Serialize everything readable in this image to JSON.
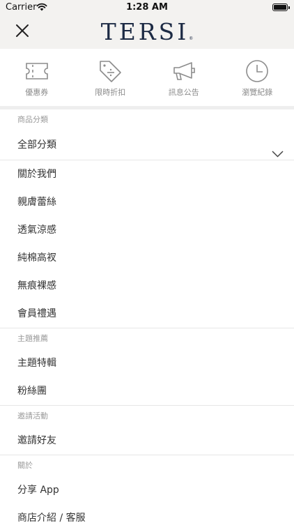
{
  "status_bar": {
    "carrier": "Carrier",
    "time": "1:28 AM",
    "battery_level": 1.0
  },
  "header": {
    "logo_text": "TERSI",
    "logo_mark": "®",
    "close_icon": "close-icon"
  },
  "shortcuts": [
    {
      "label": "優惠券",
      "icon": "ticket-icon"
    },
    {
      "label": "限時折扣",
      "icon": "discount-tag-icon"
    },
    {
      "label": "訊息公告",
      "icon": "megaphone-icon"
    },
    {
      "label": "瀏覽紀錄",
      "icon": "clock-icon"
    }
  ],
  "menu": {
    "category_section": {
      "header": "商品分類",
      "dropdown_label": "全部分類",
      "dropdown_icon": "chevron-down-icon",
      "items": [
        "關於我們",
        "親膚蕾絲",
        "透氣涼感",
        "純棉高衩",
        "無痕裸感",
        "會員禮遇"
      ]
    },
    "theme_section": {
      "header": "主題推薦",
      "items": [
        "主題特輯",
        "粉絲團"
      ]
    },
    "invite_section": {
      "header": "邀請活動",
      "items": [
        "邀請好友"
      ]
    },
    "about_section": {
      "header": "關於",
      "items": [
        "分享 App",
        "商店介紹 / 客服"
      ]
    }
  }
}
